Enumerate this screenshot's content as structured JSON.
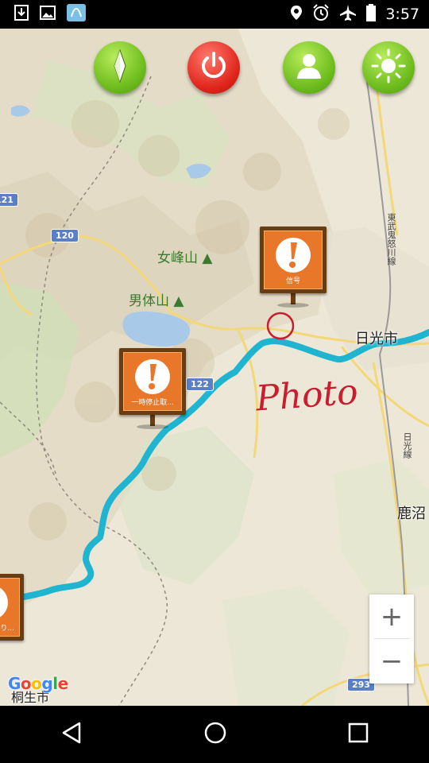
{
  "status_bar": {
    "time": "3:57",
    "left_icons": [
      "download-icon",
      "image-icon",
      "app-icon"
    ],
    "right_icons": [
      "location-icon",
      "alarm-icon",
      "airplane-mode-icon",
      "battery-icon"
    ]
  },
  "toolbar": {
    "buttons": [
      {
        "name": "compass-button",
        "color": "#7cc62a"
      },
      {
        "name": "power-button",
        "color": "#e2261c"
      },
      {
        "name": "profile-button",
        "color": "#7cc62a"
      },
      {
        "name": "brightness-button",
        "color": "#7cc62a"
      }
    ]
  },
  "map": {
    "labels": {
      "nyoho": "女峰山",
      "nantai": "男体山",
      "nikko": "日光市",
      "kanuma": "鹿沼",
      "kiryu": "桐生市",
      "tobu_line": "東武鬼怒川線",
      "nikko_line": "日光線"
    },
    "shields": {
      "r120": "120",
      "r122": "122",
      "r293": "293",
      "r121": "121"
    },
    "route_color": "#1fb4cf",
    "markers": [
      {
        "name": "signal-marker",
        "caption": "信号"
      },
      {
        "name": "stop-marker",
        "caption": "一時停止取..."
      },
      {
        "name": "edge-marker",
        "caption": "り..."
      }
    ],
    "annotation": "Photo"
  },
  "zoom": {
    "in_label": "+",
    "out_label": "−"
  },
  "attribution": {
    "logo": "Google"
  }
}
